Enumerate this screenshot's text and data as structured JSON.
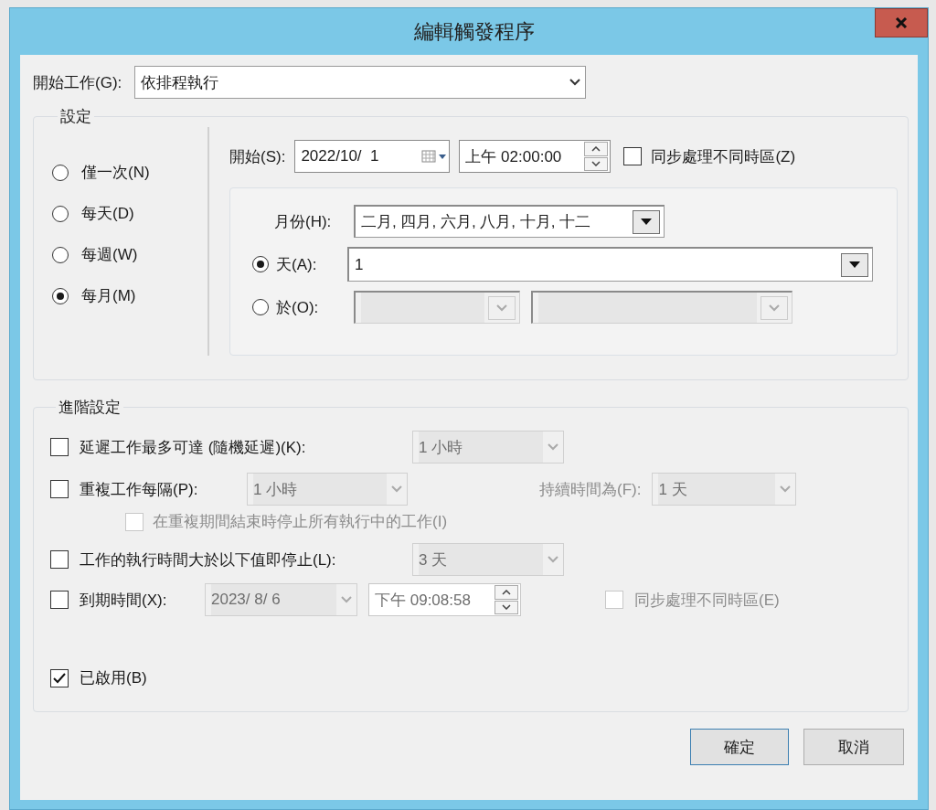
{
  "window": {
    "title": "編輯觸發程序"
  },
  "begin_task": {
    "label": "開始工作(G):",
    "value": "依排程執行"
  },
  "settings": {
    "title": "設定",
    "schedule_options": [
      {
        "label": "僅一次(N)",
        "selected": false
      },
      {
        "label": "每天(D)",
        "selected": false
      },
      {
        "label": "每週(W)",
        "selected": false
      },
      {
        "label": "每月(M)",
        "selected": true
      }
    ],
    "start": {
      "label": "開始(S):",
      "date": "2022/10/  1",
      "time": "上午 02:00:00",
      "sync": {
        "label": "同步處理不同時區(Z)",
        "checked": false
      }
    },
    "months": {
      "label": "月份(H):",
      "value": "二月, 四月, 六月, 八月, 十月, 十二"
    },
    "day_modes": [
      {
        "label": "天(A):",
        "selected": true,
        "value": "1"
      },
      {
        "label": "於(O):",
        "selected": false
      }
    ]
  },
  "advanced": {
    "title": "進階設定",
    "delay": {
      "label": "延遲工作最多可達 (隨機延遲)(K):",
      "checked": false,
      "value": "1 小時",
      "disabled": true
    },
    "repeat": {
      "label": "重複工作每隔(P):",
      "checked": false,
      "value": "1 小時",
      "disabled": true,
      "duration_label": "持續時間為(F):",
      "duration_value": "1 天"
    },
    "stop_all": {
      "label": "在重複期間結束時停止所有執行中的工作(I)",
      "checked": false,
      "disabled": true
    },
    "stop_after": {
      "label": "工作的執行時間大於以下值即停止(L):",
      "checked": false,
      "value": "3 天",
      "disabled": true
    },
    "expire": {
      "label": "到期時間(X):",
      "checked": false,
      "date": "2023/  8/  6",
      "time": "下午 09:08:58",
      "disabled": true,
      "sync": {
        "label": "同步處理不同時區(E)",
        "checked": false,
        "disabled": true
      }
    },
    "enabled": {
      "label": "已啟用(B)",
      "checked": true
    }
  },
  "buttons": [
    {
      "label": "確定",
      "default": true
    },
    {
      "label": "取消",
      "default": false
    }
  ]
}
